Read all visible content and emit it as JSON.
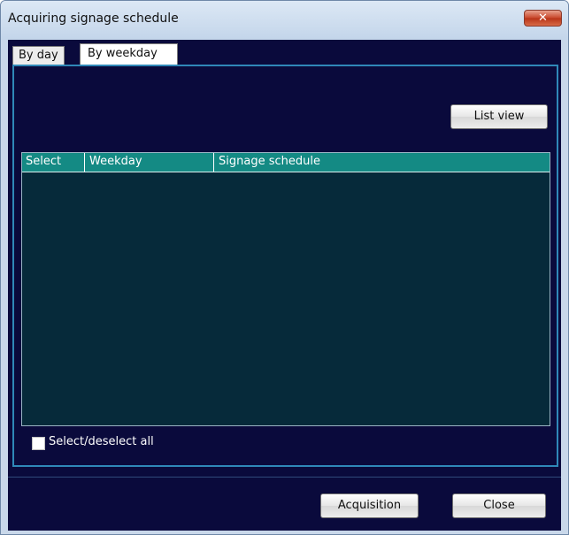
{
  "window": {
    "title": "Acquiring signage schedule",
    "close_glyph": "✕"
  },
  "tabs": [
    {
      "label": "By day",
      "selected": false
    },
    {
      "label": "By weekday",
      "selected": true
    }
  ],
  "toolbar": {
    "list_view_label": "List view"
  },
  "table": {
    "columns": [
      "Select",
      "Weekday",
      "Signage schedule"
    ],
    "rows": []
  },
  "footer": {
    "select_all_label": "Select/deselect all",
    "select_all_checked": false
  },
  "actions": {
    "acquisition_label": "Acquisition",
    "close_label": "Close"
  },
  "colors": {
    "background": "#0a0a3c",
    "header": "#148a84",
    "panel_border": "#2f88b8"
  }
}
